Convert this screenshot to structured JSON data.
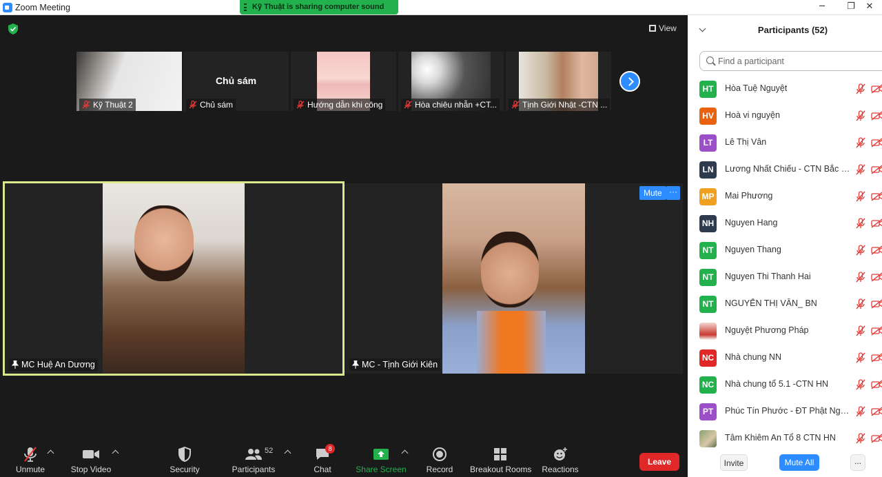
{
  "window": {
    "title": "Zoom Meeting",
    "minimize": "─",
    "maximize": "❐",
    "close": "✕"
  },
  "share_banner": "Kỹ Thuật is sharing computer sound",
  "view_label": "View",
  "thumbnails": [
    {
      "name": "Kỹ Thuật 2",
      "center": ""
    },
    {
      "name": "Chủ sám",
      "center": "Chủ sám"
    },
    {
      "name": "Hướng dẫn khi công",
      "center": ""
    },
    {
      "name": "Hòa chiêu nhẫn +CT...",
      "center": ""
    },
    {
      "name": "Tịnh Giới Nhật -CTN ...",
      "center": ""
    }
  ],
  "main_tiles": [
    {
      "name": "MC Huệ An Dương"
    },
    {
      "name": "MC - Tịnh Giới Kiên"
    }
  ],
  "tile_controls": {
    "mute": "Mute",
    "more": "···"
  },
  "toolbar": {
    "unmute": "Unmute",
    "stop_video": "Stop Video",
    "security": "Security",
    "participants": "Participants",
    "participants_count": "52",
    "chat": "Chat",
    "chat_badge": "8",
    "share_screen": "Share Screen",
    "record": "Record",
    "breakout_rooms": "Breakout Rooms",
    "reactions": "Reactions",
    "leave": "Leave"
  },
  "panel": {
    "title": "Participants (52)",
    "search_placeholder": "Find a participant",
    "invite": "Invite",
    "mute_all": "Mute All",
    "more": "..."
  },
  "participants": [
    {
      "initials": "HT",
      "name": "Hòa Tuệ Nguyệt",
      "color": "#23b14d"
    },
    {
      "initials": "HV",
      "name": "Hoà vi nguyện",
      "color": "#e8620f"
    },
    {
      "initials": "LT",
      "name": "Lê Thị Vân",
      "color": "#9b4fc8"
    },
    {
      "initials": "LN",
      "name": "Lương Nhất Chiếu - CTN Bắc Ni...",
      "color": "#2e3b4e"
    },
    {
      "initials": "MP",
      "name": "Mai Phương",
      "color": "#f0a020"
    },
    {
      "initials": "NH",
      "name": "Nguyen Hang",
      "color": "#2e3b4e"
    },
    {
      "initials": "NT",
      "name": "Nguyen Thang",
      "color": "#23b14d"
    },
    {
      "initials": "NT",
      "name": "Nguyen Thi Thanh Hai",
      "color": "#23b14d"
    },
    {
      "initials": "NT",
      "name": "NGUYỄN THỊ VÂN_ BN",
      "color": "#23b14d"
    },
    {
      "initials": "",
      "name": "Nguyệt Phương Pháp",
      "color": "photo"
    },
    {
      "initials": "NC",
      "name": "Nhà chung NN",
      "color": "#e02828"
    },
    {
      "initials": "NC",
      "name": "Nhà chung tổ 5.1 -CTN HN",
      "color": "#23b14d"
    },
    {
      "initials": "PT",
      "name": "Phúc Tín Phước - ĐT Phật Nghĩa...",
      "color": "#9b4fc8"
    },
    {
      "initials": "",
      "name": "Tâm Khiêm An Tổ 8 CTN HN",
      "color": "photo2"
    }
  ]
}
